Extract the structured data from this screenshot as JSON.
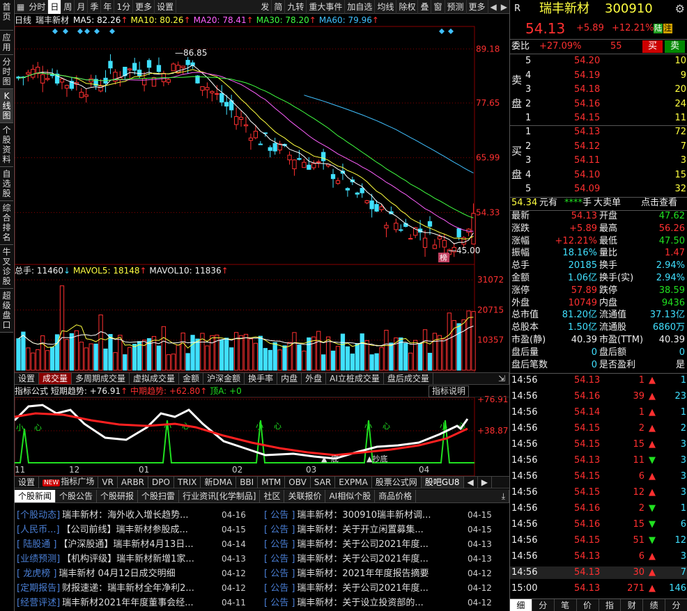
{
  "nav": {
    "left": [
      "首页",
      "应用",
      "分时图",
      "K线图",
      "个股资料",
      "自选股",
      "综合排名",
      "牛叉诊股",
      "超级盘口"
    ]
  },
  "toolbar": {
    "tabs": [
      "分时",
      "日",
      "周",
      "月",
      "季",
      "年",
      "1分",
      "更多",
      "设置"
    ],
    "active": "日",
    "right": [
      "发",
      "简",
      "九转",
      "重大事件",
      "加自选",
      "均线",
      "除权",
      "叠",
      "窗",
      "预测",
      "更多"
    ]
  },
  "chart": {
    "period": "日线",
    "name": "瑞丰新材",
    "ma": [
      {
        "label": "MA5: 82.26",
        "color": "#ffffff"
      },
      {
        "label": "MA10: 80.26",
        "color": "#ffff40"
      },
      {
        "label": "MA20: 78.41",
        "color": "#ff60ff"
      },
      {
        "label": "MA30: 78.20",
        "color": "#40ff40"
      },
      {
        "label": "MA60: 79.96",
        "color": "#40c0ff"
      }
    ],
    "yticks": [
      "89.18",
      "77.65",
      "65.99",
      "54.33"
    ],
    "high_label": "86.85",
    "low_label": "45.00",
    "bang": "榜"
  },
  "volume": {
    "header": "总手: 11460",
    "mavol5": "MAVOL5: 18148",
    "mavol10": "MAVOL10: 11836",
    "yticks": [
      "31072",
      "20715",
      "10357"
    ]
  },
  "tabs2": [
    "设置",
    "成交量",
    "多周期成交量",
    "虚拟成交量",
    "金额",
    "沪深金额",
    "换手率",
    "内盘",
    "外盘",
    "AI立桩成交量",
    "盘后成交量"
  ],
  "tabs2_active": "成交量",
  "indicator": {
    "name": "指标公式",
    "short": "短期趋势: +76.91",
    "mid": "中期趋势: +62.80",
    "top": "顶A: +0",
    "explain": "指标说明",
    "yticks": [
      "+76.91",
      "+38.87"
    ],
    "xsmall": "小",
    "xheart": "心",
    "bottom_text": "底",
    "bottom_label": "抄底"
  },
  "xaxis": [
    "11",
    "12",
    "01",
    "02",
    "03",
    "04"
  ],
  "tabs3": [
    "设置",
    "指标广场",
    "VR",
    "ARBR",
    "DPO",
    "TRIX",
    "新DMA",
    "BBI",
    "MTM",
    "OBV",
    "SAR",
    "EXPMA",
    "股票公式网",
    "股吧GU8"
  ],
  "new_badge": "NEW",
  "tabs4": [
    "个股新闻",
    "个股公告",
    "个股研报",
    "个股扫雷",
    "行业资讯[化学制品]",
    "社区",
    "关联报价",
    "AI相似个股",
    "商品价格"
  ],
  "tabs4_active": "个股新闻",
  "news_left": [
    {
      "tag": "[个股动态]",
      "title": "瑞丰新材：海外收入增长趋势...",
      "date": "04-16"
    },
    {
      "tag": "[人民币...]",
      "title": "【公司前线】瑞丰新材参股成...",
      "date": "04-15"
    },
    {
      "tag": "[ 陆股通 ]",
      "title": "【沪深股通】瑞丰新材4月13日...",
      "date": "04-14"
    },
    {
      "tag": "[业绩预测]",
      "title": "【机构评级】瑞丰新材新增1家...",
      "date": "04-13"
    },
    {
      "tag": "[ 龙虎榜 ]",
      "title": "瑞丰新材 04月12日成交明细",
      "date": "04-12"
    },
    {
      "tag": "[定期报告]",
      "title": "财报速递：瑞丰新材全年净利2...",
      "date": "04-12"
    },
    {
      "tag": "[经营评述]",
      "title": "瑞丰新材2021年年度董事会经...",
      "date": "04-11"
    }
  ],
  "news_right": [
    {
      "tag": "[  公告  ]",
      "title": "瑞丰新材：300910瑞丰新材调...",
      "date": "04-15"
    },
    {
      "tag": "[  公告  ]",
      "title": "瑞丰新材：关于开立闲置募集...",
      "date": "04-15"
    },
    {
      "tag": "[  公告  ]",
      "title": "瑞丰新材：关于公司2021年度...",
      "date": "04-13"
    },
    {
      "tag": "[  公告  ]",
      "title": "瑞丰新材：关于公司2021年度...",
      "date": "04-13"
    },
    {
      "tag": "[  公告  ]",
      "title": "瑞丰新材：2021年年度报告摘要",
      "date": "04-12"
    },
    {
      "tag": "[  公告  ]",
      "title": "瑞丰新材：关于公司2021年度...",
      "date": "04-12"
    },
    {
      "tag": "[  公告  ]",
      "title": "瑞丰新材：关于设立投资部的...",
      "date": "04-12"
    }
  ],
  "quote": {
    "r": "R",
    "name": "瑞丰新材",
    "code": "300910",
    "price": "54.13",
    "change": "+5.89",
    "pct": "+12.21%",
    "badge_lu": "陆",
    "badge_zhu": "注",
    "weibi_label": "委比",
    "weibi": "+27.09%",
    "weicha": "55",
    "buy": "买",
    "sell": "卖",
    "sell_label": [
      "卖",
      "盘"
    ],
    "buy_label": [
      "买",
      "盘"
    ],
    "asks": [
      {
        "lvl": "5",
        "price": "54.20",
        "vol": "10"
      },
      {
        "lvl": "4",
        "price": "54.19",
        "vol": "9"
      },
      {
        "lvl": "3",
        "price": "54.18",
        "vol": "20"
      },
      {
        "lvl": "2",
        "price": "54.16",
        "vol": "24"
      },
      {
        "lvl": "1",
        "price": "54.15",
        "vol": "11"
      }
    ],
    "bids": [
      {
        "lvl": "1",
        "price": "54.13",
        "vol": "72"
      },
      {
        "lvl": "2",
        "price": "54.12",
        "vol": "7"
      },
      {
        "lvl": "3",
        "price": "54.11",
        "vol": "3"
      },
      {
        "lvl": "4",
        "price": "54.10",
        "vol": "15"
      },
      {
        "lvl": "5",
        "price": "54.09",
        "vol": "32"
      }
    ],
    "big": {
      "v": "54.34",
      "unit": "元有",
      "stars": "****",
      "hand": "手",
      "deal": "大卖单",
      "click": "点击查看"
    },
    "stats": [
      [
        "最新",
        "54.13",
        "red",
        "开盘",
        "47.62",
        "green"
      ],
      [
        "涨跌",
        "+5.89",
        "red",
        "最高",
        "56.26",
        "red"
      ],
      [
        "涨幅",
        "+12.21%",
        "red",
        "最低",
        "47.50",
        "green"
      ],
      [
        "振幅",
        "18.16%",
        "cyan",
        "量比",
        "1.47",
        "red"
      ],
      [
        "总手",
        "20185",
        "cyan",
        "换手",
        "2.94%",
        "cyan"
      ],
      [
        "金额",
        "1.06亿",
        "cyan",
        "换手(实)",
        "2.94%",
        "cyan"
      ],
      [
        "涨停",
        "57.89",
        "red",
        "跌停",
        "38.59",
        "green"
      ],
      [
        "外盘",
        "10749",
        "red",
        "内盘",
        "9436",
        "green"
      ],
      [
        "总市值",
        "81.20亿",
        "cyan",
        "流通值",
        "37.13亿",
        "cyan"
      ],
      [
        "总股本",
        "1.50亿",
        "cyan",
        "流通股",
        "6860万",
        "cyan"
      ],
      [
        "市盈(静)",
        "40.39",
        "white",
        "市盈(TTM)",
        "40.39",
        "white"
      ],
      [
        "盘后量",
        "0",
        "cyan",
        "盘后额",
        "0",
        "cyan"
      ],
      [
        "盘后笔数",
        "0",
        "cyan",
        "是否盈利",
        "是",
        "white"
      ]
    ],
    "ticks": [
      {
        "t": "14:56",
        "p": "54.13",
        "v": "1",
        "d": "up",
        "n": "1"
      },
      {
        "t": "14:56",
        "p": "54.16",
        "v": "39",
        "d": "up",
        "n": "23"
      },
      {
        "t": "14:56",
        "p": "54.14",
        "v": "1",
        "d": "up",
        "n": "1"
      },
      {
        "t": "14:56",
        "p": "54.15",
        "v": "2",
        "d": "up",
        "n": "2"
      },
      {
        "t": "14:56",
        "p": "54.15",
        "v": "15",
        "d": "up",
        "n": "3"
      },
      {
        "t": "14:56",
        "p": "54.13",
        "v": "11",
        "d": "down",
        "n": "3"
      },
      {
        "t": "14:56",
        "p": "54.15",
        "v": "6",
        "d": "up",
        "n": "3"
      },
      {
        "t": "14:56",
        "p": "54.15",
        "v": "12",
        "d": "up",
        "n": "3"
      },
      {
        "t": "14:56",
        "p": "54.16",
        "v": "2",
        "d": "down",
        "n": "1"
      },
      {
        "t": "14:56",
        "p": "54.16",
        "v": "15",
        "d": "down",
        "n": "6"
      },
      {
        "t": "14:56",
        "p": "54.15",
        "v": "51",
        "d": "down",
        "n": "12"
      },
      {
        "t": "14:56",
        "p": "54.13",
        "v": "6",
        "d": "up",
        "n": "3"
      },
      {
        "t": "14:56",
        "p": "54.13",
        "v": "30",
        "d": "up",
        "n": "7"
      },
      {
        "t": "15:00",
        "p": "54.13",
        "v": "271",
        "d": "up",
        "n": "146"
      }
    ],
    "bottom_tabs": [
      "细",
      "分",
      "笔",
      "价",
      "指",
      "财",
      "绩",
      "分"
    ]
  }
}
